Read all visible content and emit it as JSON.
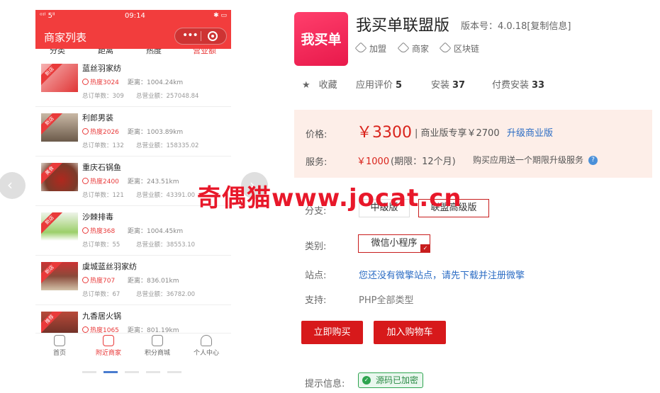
{
  "phone": {
    "status": {
      "carrier": "ᵒᶦˡ 5ᴵᴵ",
      "time": "09:14",
      "right": "✱ ▭"
    },
    "title": "商家列表",
    "filter_tabs": [
      "分类",
      "距离",
      "热度",
      "营业额"
    ],
    "shops": [
      {
        "ribbon": "新店",
        "name": "蓝丝羽家纺",
        "heat": "热度3024",
        "distance": "距离：1004.24km",
        "orders": "总订单数：309",
        "revenue": "总营业额：257048.84"
      },
      {
        "ribbon": "新店",
        "name": "利郎男装",
        "heat": "热度2026",
        "distance": "距离：1003.89km",
        "orders": "总订单数：132",
        "revenue": "总营业额：158335.02"
      },
      {
        "ribbon": "美食",
        "name": "重庆石锅鱼",
        "heat": "热度2400",
        "distance": "距离：243.51km",
        "orders": "总订单数：121",
        "revenue": "总营业额：43391.00"
      },
      {
        "ribbon": "新店",
        "name": "沙棘排毒",
        "heat": "热度368",
        "distance": "距离：1004.45km",
        "orders": "总订单数：55",
        "revenue": "总营业额：38553.10"
      },
      {
        "ribbon": "新店",
        "name": "虞城蓝丝羽家纺",
        "heat": "热度707",
        "distance": "距离：836.01km",
        "orders": "总订单数：67",
        "revenue": "总营业额：36782.00"
      },
      {
        "ribbon": "推荐",
        "name": "九香居火锅",
        "heat": "热度1065",
        "distance": "距离：801.19km",
        "orders": "",
        "revenue": ""
      }
    ],
    "tabbar": [
      {
        "label": "首页",
        "active": false
      },
      {
        "label": "附近商家",
        "active": true
      },
      {
        "label": "积分商城",
        "active": false
      },
      {
        "label": "个人中心",
        "active": false
      }
    ]
  },
  "product": {
    "logo_text": "我买单",
    "title": "我买单联盟版",
    "version": "版本号：4.0.18[复制信息]",
    "tags": [
      "加盟",
      "商家",
      "区块链"
    ],
    "favorite": "收藏",
    "rating_label": "应用评价",
    "rating_value": "5",
    "install_label": "安装",
    "install_value": "37",
    "paid_install_label": "付费安装",
    "paid_install_value": "33"
  },
  "pricing": {
    "price_label": "价格:",
    "price": "￥3300",
    "pro_price": "| 商业版专享￥2700",
    "upgrade_link": "升级商业版",
    "service_label": "服务:",
    "service_price": "￥1000",
    "service_period": "(期限：12个月)",
    "service_note": "购买应用送一个期限升级服务",
    "help_icon": "?"
  },
  "options": {
    "branch_label": "分支:",
    "branches": [
      "中级版",
      "联盟高级版"
    ],
    "category_label": "类别:",
    "category": "微信小程序",
    "site_label": "站点:",
    "site_link": "您还没有微擎站点，请先下载并注册微擎",
    "support_label": "支持:",
    "support_value": "PHP全部类型"
  },
  "actions": {
    "buy": "立即购买",
    "cart": "加入购物车"
  },
  "notice": {
    "label": "提示信息:",
    "badge": "源码已加密"
  },
  "watermark": "奇偶猫www.jocat.cn",
  "colors": {
    "brand_red": "#d7191b",
    "link_blue": "#2b6cc4",
    "price_bg": "#fdeee8"
  }
}
